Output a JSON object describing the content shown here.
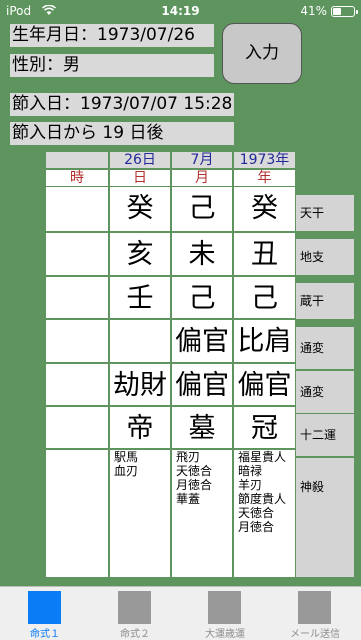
{
  "status": {
    "carrier": "iPod",
    "time": "14:19",
    "battery_text": "41%",
    "battery_level": 0.41
  },
  "info": {
    "dob": "生年月日：1973/07/26",
    "sex": "性別：男",
    "setsunyu": "節入日：1973/07/07 15:28",
    "after": "節入日から 19 日後"
  },
  "input_button": "入力",
  "header": {
    "dates": [
      "",
      "26日",
      "7月",
      "1973年"
    ],
    "pillars": [
      "時",
      "日",
      "月",
      "年"
    ]
  },
  "rows": {
    "tenkan": [
      "",
      "癸",
      "己",
      "癸"
    ],
    "chishi": [
      "",
      "亥",
      "未",
      "丑"
    ],
    "zoukan": [
      "",
      "壬",
      "己",
      "己"
    ],
    "tsuhen1": [
      "",
      "",
      "偏官",
      "比肩"
    ],
    "tsuhen2": [
      "",
      "劫財",
      "偏官",
      "偏官"
    ],
    "juuniun": [
      "",
      "帝",
      "墓",
      "冠"
    ],
    "shinsatsu": [
      "",
      "駅馬\n血刃",
      "飛刃\n天徳合\n月徳合\n華蓋",
      "福星貴人\n暗禄\n羊刃\n節度貴人\n天徳合\n月徳合"
    ]
  },
  "row_labels": {
    "tenkan": "天干",
    "chishi": "地支",
    "zoukan": "蔵干",
    "tsuhen1": "通変",
    "tsuhen2": "通変",
    "juuniun": "十二運",
    "shinsatsu": "神殺"
  },
  "tabs": [
    {
      "label": "命式１",
      "icon": "square-tab-icon",
      "active": true
    },
    {
      "label": "命式２",
      "icon": "square-tab-icon",
      "active": false
    },
    {
      "label": "大運歳運",
      "icon": "square-tab-icon",
      "active": false
    },
    {
      "label": "メール送信",
      "icon": "square-tab-icon",
      "active": false
    }
  ],
  "colors": {
    "background": "#5e955e",
    "date_header": "#222a99",
    "pillar_header": "#b3312e",
    "tab_active": "#0a7cf5"
  }
}
